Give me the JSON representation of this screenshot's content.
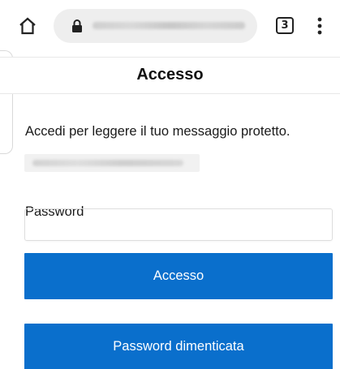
{
  "browser": {
    "tabs_count": "3"
  },
  "header": {
    "title": "Accesso"
  },
  "form": {
    "prompt": "Accedi per leggere il tuo messaggio protetto.",
    "password_label": "Password",
    "login_button": "Accesso",
    "forgot_button": "Password dimenticata"
  },
  "colors": {
    "primary_button": "#0a6fcc",
    "button_text": "#ffffff",
    "url_bar": "#eeeeee"
  },
  "icons": {
    "home": "home-icon",
    "lock": "lock-icon",
    "tabs": "tabs-count-icon",
    "menu": "kebab-menu-icon"
  }
}
